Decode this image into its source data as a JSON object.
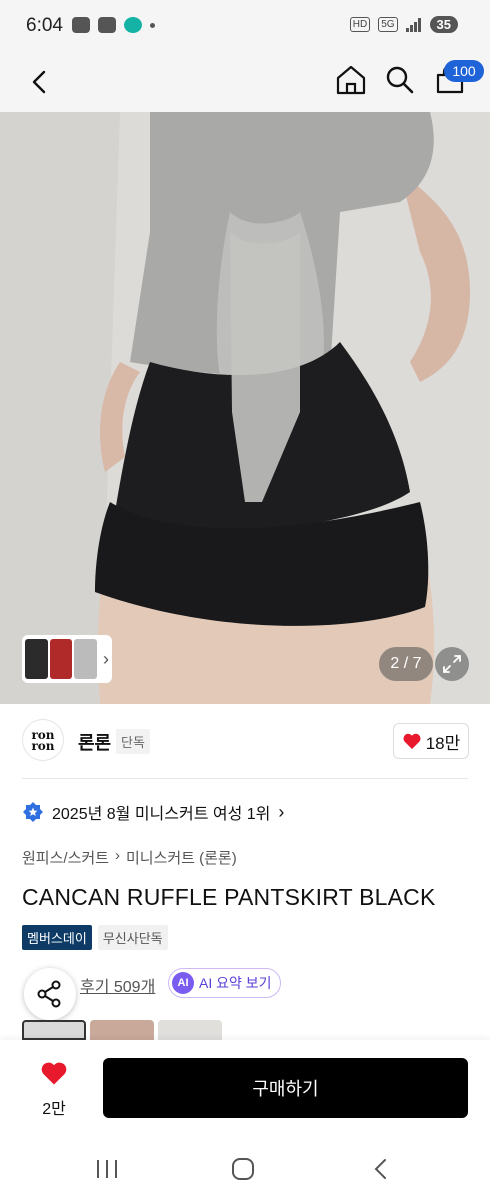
{
  "status_bar": {
    "time": "6:04",
    "network": "5G",
    "hd": "HD",
    "battery": "35"
  },
  "header": {
    "cart_count": "100"
  },
  "gallery": {
    "page_indicator": "2 / 7"
  },
  "brand": {
    "logo_text_1": "ron",
    "logo_text_2": "ron",
    "name": "론론",
    "tag": "단독",
    "likes": "18만"
  },
  "ranking": {
    "text": "2025년 8월 미니스커트 여성 1위"
  },
  "breadcrumb": {
    "category": "원피스/스커트",
    "subcategory": "미니스커트 (론론)"
  },
  "product": {
    "title": "CANCAN RUFFLE PANTSKIRT BLACK",
    "tags": [
      "멤버스데이",
      "무신사단독"
    ],
    "review_link": "후기 509개",
    "ai_button": "AI 요약 보기",
    "ai_badge": "AI"
  },
  "bottom_bar": {
    "wish_count": "2만",
    "buy_label": "구매하기"
  },
  "colors": {
    "accent": "#1e63d8",
    "heart": "#e8192c",
    "tag_dark": "#0d3b66",
    "ai_purple": "#7b5cf0"
  }
}
